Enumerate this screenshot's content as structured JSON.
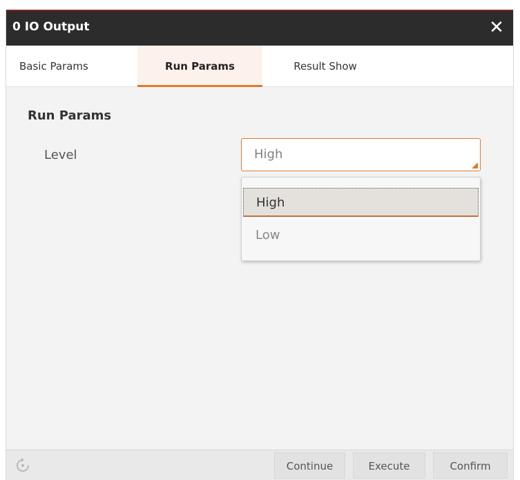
{
  "window": {
    "title": "0 IO Output",
    "close_glyph": "✕",
    "accent_color": "#e07a2e",
    "titlebar_color": "#2c2c2c"
  },
  "tabs": [
    {
      "label": "Basic Params",
      "active": false
    },
    {
      "label": "Run Params",
      "active": true
    },
    {
      "label": "Result Show",
      "active": false
    }
  ],
  "run_params": {
    "section_title": "Run Params",
    "level": {
      "label": "Level",
      "value": "High",
      "options": [
        "High",
        "Low"
      ],
      "highlighted_option": "High"
    }
  },
  "footer": {
    "refresh_icon": "refresh-icon",
    "buttons": {
      "continue": "Continue",
      "execute": "Execute",
      "confirm": "Confirm"
    }
  }
}
